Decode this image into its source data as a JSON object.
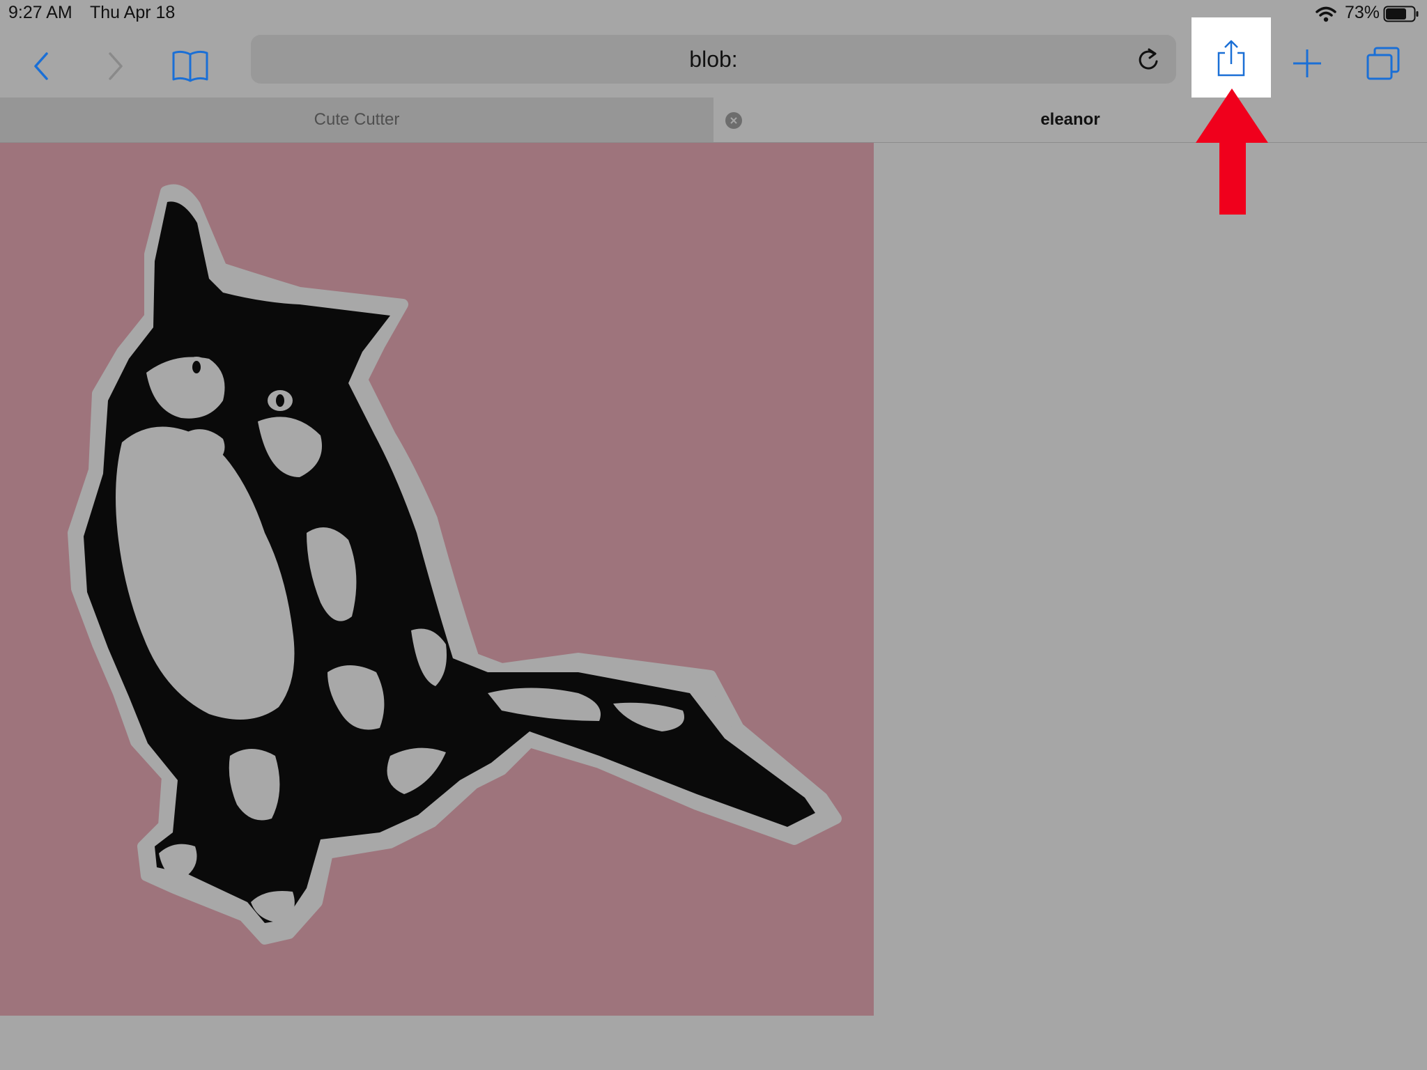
{
  "status_bar": {
    "time": "9:27 AM",
    "date": "Thu Apr 18",
    "battery_percent": "73%",
    "battery_level": 0.73
  },
  "toolbar": {
    "address": "blob:"
  },
  "tabs": [
    {
      "label": "Cute Cutter",
      "active": false
    },
    {
      "label": "eleanor",
      "active": true
    }
  ],
  "colors": {
    "accent": "#1a6fd6",
    "image_background": "#9e747c",
    "annotation_arrow": "#f0001c"
  },
  "icons": [
    "back-icon",
    "forward-icon",
    "bookmarks-icon",
    "reload-icon",
    "share-icon",
    "plus-icon",
    "tabs-icon",
    "close-icon",
    "wifi-icon",
    "battery-icon"
  ]
}
